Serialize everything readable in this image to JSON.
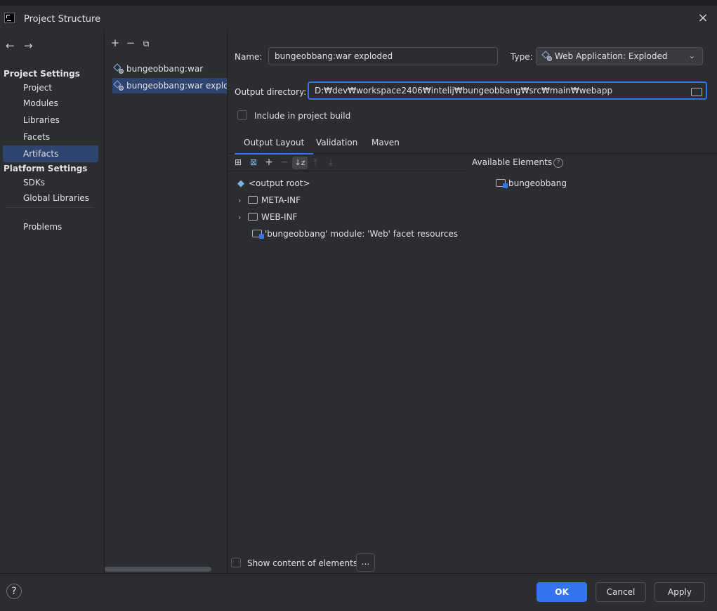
{
  "window": {
    "title": "Project Structure",
    "close_icon": "×"
  },
  "sidebar": {
    "back_icon": "←",
    "forward_icon": "→",
    "project_settings_header": "Project Settings",
    "project_items": [
      {
        "label": "Project"
      },
      {
        "label": "Modules"
      },
      {
        "label": "Libraries"
      },
      {
        "label": "Facets"
      },
      {
        "label": "Artifacts",
        "selected": true
      }
    ],
    "platform_settings_header": "Platform Settings",
    "platform_items": [
      {
        "label": "SDKs"
      },
      {
        "label": "Global Libraries"
      }
    ],
    "problems_label": "Problems"
  },
  "artifacts": {
    "toolbar": {
      "add_icon": "+",
      "remove_icon": "−",
      "copy_icon": "⧉"
    },
    "items": [
      {
        "label": "bungeobbang:war",
        "selected": false
      },
      {
        "label": "bungeobbang:war exploded",
        "selected": true
      }
    ]
  },
  "details": {
    "name_label": "Name:",
    "name_value": "bungeobbang:war exploded",
    "type_label": "Type:",
    "type_value": "Web Application: Exploded",
    "output_dir_label": "Output directory:",
    "output_dir_value": "D:₩dev₩workspace2406₩intelij₩bungeobbang₩src₩main₩webapp",
    "include_label": "Include in project build",
    "include_checked": false,
    "tabs": [
      {
        "label": "Output Layout",
        "active": true
      },
      {
        "label": "Validation",
        "active": false
      },
      {
        "label": "Maven",
        "active": false
      }
    ],
    "available_elements_label": "Available Elements",
    "available_elements": [
      {
        "label": "bungeobbang"
      }
    ],
    "tree": {
      "root": "<output root>",
      "children": [
        {
          "label": "META-INF",
          "type": "folder"
        },
        {
          "label": "WEB-INF",
          "type": "folder"
        },
        {
          "label": "'bungeobbang' module: 'Web' facet resources",
          "type": "module-resource"
        }
      ]
    },
    "show_content_label": "Show content of elements",
    "show_content_checked": false,
    "ellipsis_button": "..."
  },
  "footer": {
    "help_label": "?",
    "ok_label": "OK",
    "cancel_label": "Cancel",
    "apply_label": "Apply"
  },
  "colors": {
    "accent": "#3574f0",
    "selection": "#2e436e",
    "background": "#2b2d30"
  }
}
